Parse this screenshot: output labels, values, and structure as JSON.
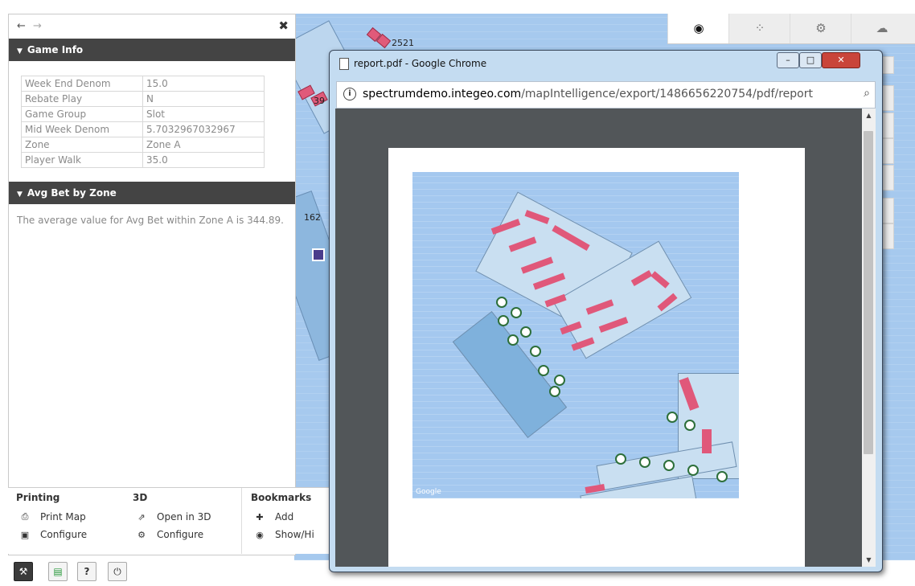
{
  "panel": {
    "game_info": {
      "title": "Game Info",
      "rows": [
        {
          "key": "Week End Denom",
          "value": "15.0"
        },
        {
          "key": "Rebate Play",
          "value": "N"
        },
        {
          "key": "Game Group",
          "value": "Slot"
        },
        {
          "key": "Mid Week Denom",
          "value": "5.7032967032967"
        },
        {
          "key": "Zone",
          "value": "Zone A"
        },
        {
          "key": "Player Walk",
          "value": "35.0"
        }
      ]
    },
    "avg_bet": {
      "title": "Avg Bet by Zone",
      "text": "The average value for Avg Bet within Zone A is 344.89."
    }
  },
  "tools": {
    "printing": {
      "title": "Printing",
      "items": [
        "Print Map",
        "Configure"
      ]
    },
    "three_d": {
      "title": "3D",
      "items": [
        "Open in 3D",
        "Configure"
      ]
    },
    "bookmarks": {
      "title": "Bookmarks",
      "items": [
        "Add",
        "Show/Hi"
      ]
    }
  },
  "map": {
    "labels": [
      "2521",
      "39",
      "162"
    ]
  },
  "popup": {
    "title": "report.pdf - Google Chrome",
    "url_host": "spectrumdemo.integeo.com",
    "url_path": "/mapIntelligence/export/1486656220754/pdf/report",
    "map_attribution": "Google"
  },
  "colors": {
    "header": "#444444",
    "map_water": "#a6c9ee",
    "slot": "#e05a7a",
    "viewer_bg": "#525659"
  }
}
